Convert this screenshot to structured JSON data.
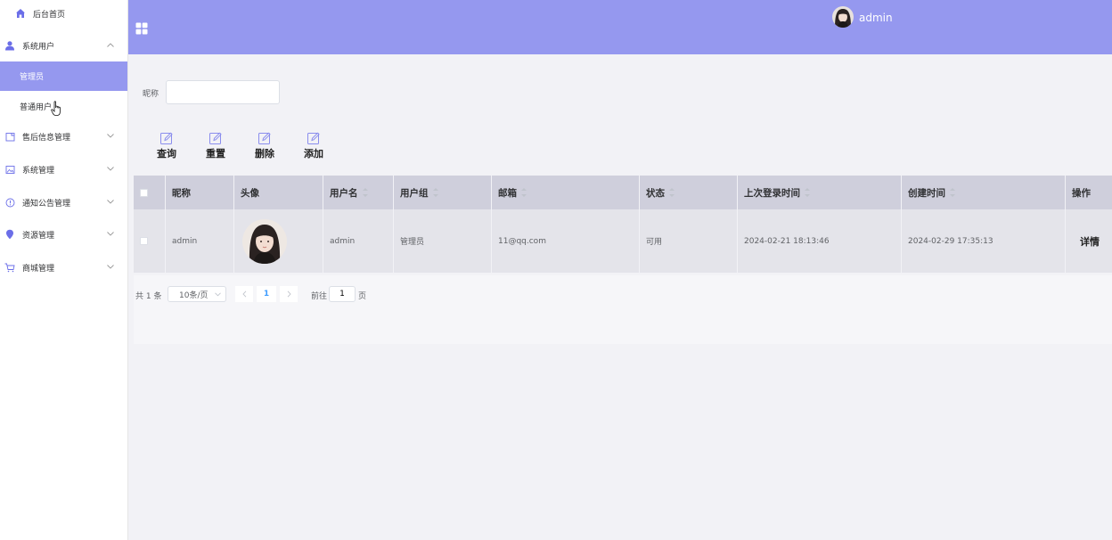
{
  "sidebar": {
    "home": {
      "label": "后台首页",
      "icon": "home-icon"
    },
    "system_users": {
      "label": "系统用户",
      "icon": "user-icon",
      "expanded": true
    },
    "sub_items": [
      {
        "label": "管理员",
        "active": true
      },
      {
        "label": "普通用户",
        "active": false
      }
    ],
    "menus": [
      {
        "label": "售后信息管理",
        "icon": "document-icon"
      },
      {
        "label": "系统管理",
        "icon": "image-icon"
      },
      {
        "label": "通知公告管理",
        "icon": "info-icon"
      },
      {
        "label": "资源管理",
        "icon": "location-icon"
      },
      {
        "label": "商城管理",
        "icon": "cart-icon"
      }
    ]
  },
  "header": {
    "username": "admin",
    "background": "#9598ef"
  },
  "search": {
    "label": "昵称",
    "value": "",
    "placeholder": ""
  },
  "actions": [
    {
      "label": "查询",
      "icon": "edit-icon"
    },
    {
      "label": "重置",
      "icon": "edit-icon"
    },
    {
      "label": "删除",
      "icon": "edit-icon"
    },
    {
      "label": "添加",
      "icon": "edit-icon"
    }
  ],
  "table": {
    "columns": [
      "昵称",
      "头像",
      "用户名",
      "用户组",
      "邮箱",
      "状态",
      "上次登录时间",
      "创建时间",
      "操作"
    ],
    "rows": [
      {
        "nickname": "admin",
        "username": "admin",
        "group": "管理员",
        "email": "11@qq.com",
        "status": "可用",
        "last_login": "2024-02-21 18:13:46",
        "created": "2024-02-29 17:35:13",
        "action": "详情"
      }
    ]
  },
  "pagination": {
    "total": "共 1 条",
    "page_size": "10条/页",
    "current_page": "1",
    "goto_label": "前往",
    "goto_value": "1",
    "page_suffix": "页"
  },
  "colors": {
    "accent": "#9598ef",
    "header_row": "#cfcfdc",
    "body_row": "#e4e4ea",
    "page_bg": "#f2f2f6"
  }
}
